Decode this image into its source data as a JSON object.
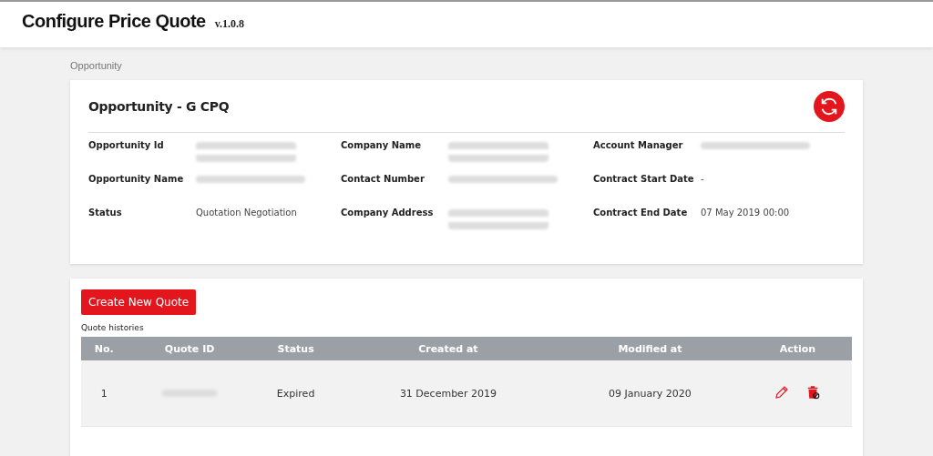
{
  "app": {
    "title": "Configure Price Quote",
    "version": "v.1.0.8"
  },
  "breadcrumb": "Opportunity",
  "opportunity": {
    "title": "Opportunity - G CPQ",
    "fields": [
      {
        "label": "Opportunity Id",
        "kind": "redacted_wrapped"
      },
      {
        "label": "Company Name",
        "kind": "redacted_wrapped"
      },
      {
        "label": "Account Manager",
        "kind": "redacted"
      },
      {
        "label": "Opportunity Name",
        "kind": "redacted"
      },
      {
        "label": "Contact Number",
        "kind": "redacted"
      },
      {
        "label": "Contract Start Date",
        "value": "-"
      },
      {
        "label": "Status",
        "value": "Quotation Negotiation"
      },
      {
        "label": "Company Address",
        "kind": "redacted_wrapped"
      },
      {
        "label": "Contract End Date",
        "value": "07 May 2019 00:00"
      }
    ]
  },
  "quotes": {
    "create_button": "Create New Quote",
    "caption": "Quote histories",
    "columns": [
      "No.",
      "Quote ID",
      "Status",
      "Created at",
      "Modified at",
      "Action"
    ],
    "rows": [
      {
        "no": "1",
        "quote_id_redacted": true,
        "status": "Expired",
        "created": "31 December 2019",
        "modified": "09 January 2020"
      }
    ]
  }
}
